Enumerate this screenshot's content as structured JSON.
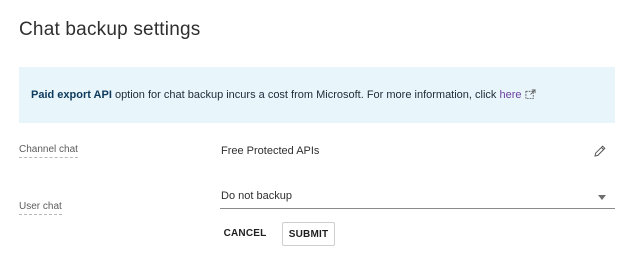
{
  "page": {
    "title": "Chat backup settings"
  },
  "banner": {
    "bold_text": "Paid export API",
    "text": " option for chat backup incurs a cost from Microsoft. For more information, click ",
    "link_text": "here",
    "link_icon": "external-link-icon"
  },
  "channel_chat": {
    "label": "Channel chat",
    "value": "Free Protected APIs",
    "edit_icon": "pencil-icon"
  },
  "user_chat": {
    "label": "User chat",
    "selected": "Do not backup",
    "caret_icon": "caret-down-icon"
  },
  "actions": {
    "cancel_label": "CANCEL",
    "submit_label": "SUBMIT"
  },
  "colors": {
    "banner_bg": "#e8f5fb",
    "link": "#6b3fa0"
  }
}
